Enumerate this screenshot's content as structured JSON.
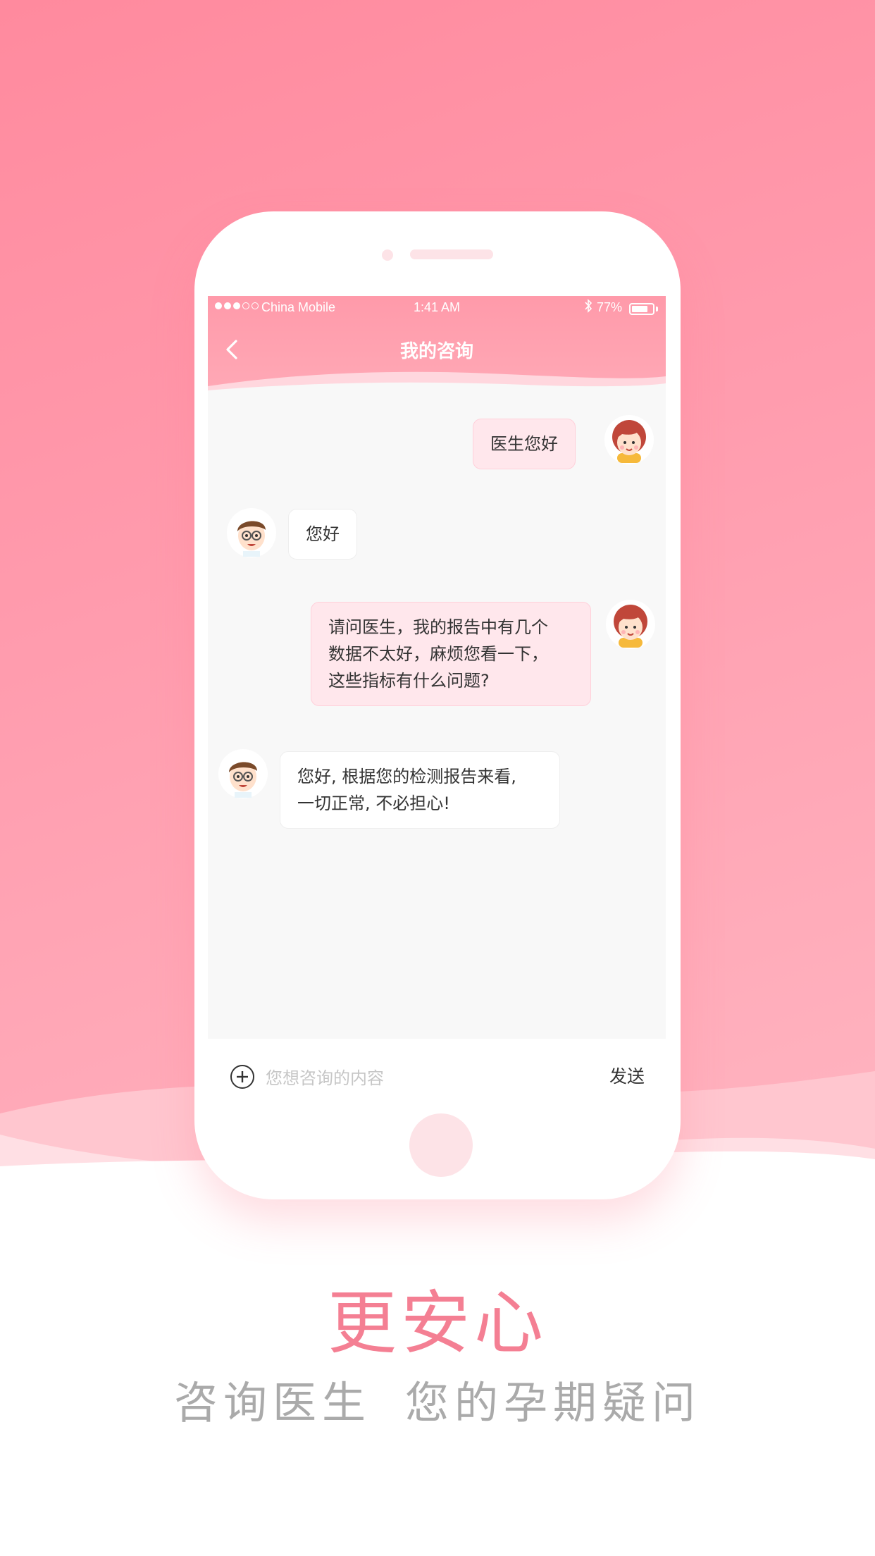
{
  "status_bar": {
    "carrier": "China Mobile",
    "time": "1:41 AM",
    "battery": "77%",
    "battery_level": 0.77
  },
  "nav": {
    "title": "我的咨询"
  },
  "messages": [
    {
      "sender": "user",
      "text": "医生您好"
    },
    {
      "sender": "doctor",
      "text": "您好"
    },
    {
      "sender": "user",
      "lines": [
        "请问医生，我的报告中有几个",
        "数据不太好，麻烦您看一下，",
        "这些指标有什么问题?"
      ]
    },
    {
      "sender": "doctor",
      "lines": [
        "您好, 根据您的检测报告来看,",
        "一切正常, 不必担心!"
      ]
    }
  ],
  "input": {
    "placeholder": "您想咨询的内容",
    "send_label": "发送"
  },
  "caption": {
    "headline": "更安心",
    "sub_left": "咨询医生",
    "sub_right": "您的孕期疑问"
  },
  "colors": {
    "brand_pink": "#ff8a9e",
    "headline": "#f47f93",
    "user_bubble": "#ffe7ec",
    "doctor_bubble": "#ffffff"
  }
}
